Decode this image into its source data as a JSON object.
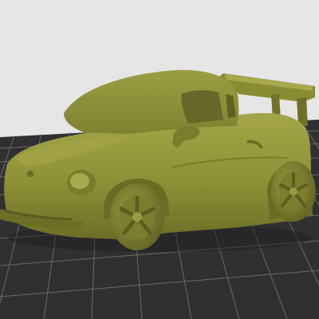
{
  "viewport": {
    "background_color": "#e6e6e6",
    "build_plate_color": "#303033",
    "grid_line_color": "#6a6a6e",
    "model_color": "#8e9036",
    "model_shadow_color": "#5f6122",
    "model_highlight_color": "#b4b65a"
  },
  "model": {
    "icon": "toy-car-3d-model"
  }
}
